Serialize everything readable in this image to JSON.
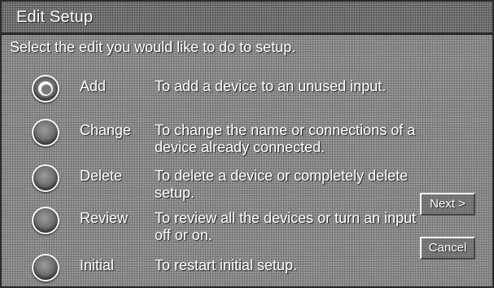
{
  "window": {
    "title": "Edit Setup"
  },
  "instruction": "Select the edit you would like to do to setup.",
  "options": [
    {
      "label": "Add",
      "description": "To add a device to an unused input.",
      "selected": true
    },
    {
      "label": "Change",
      "description": "To change the name or connections of a device already connected.",
      "selected": false
    },
    {
      "label": "Delete",
      "description": "To delete a device or completely delete setup.",
      "selected": false
    },
    {
      "label": "Review",
      "description": "To review all the devices or turn an input off or on.",
      "selected": false
    },
    {
      "label": "Initial",
      "description": "To restart initial setup.",
      "selected": false
    }
  ],
  "buttons": {
    "next_label": "Next >",
    "cancel_label": "Cancel"
  },
  "colors": {
    "panel_background": "#8a8a8a",
    "title_bar": "#6e6e6e",
    "text": "#ffffff",
    "border": "#2a2a2a"
  }
}
